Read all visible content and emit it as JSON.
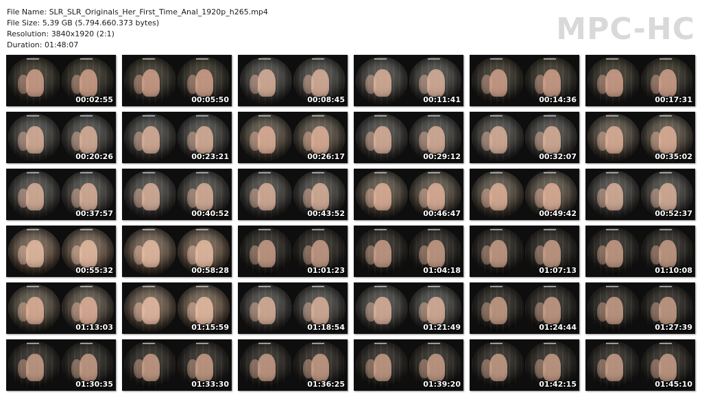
{
  "header": {
    "file_name_label": "File Name:",
    "file_name": "SLR_SLR_Originals_Her_First_Time_Anal_1920p_h265.mp4",
    "file_size_label": "File Size:",
    "file_size": "5,39 GB (5.794.660.373 bytes)",
    "resolution_label": "Resolution:",
    "resolution": "3840x1920 (2:1)",
    "duration_label": "Duration:",
    "duration": "01:48:07"
  },
  "logo": "MPC-HC",
  "thumbnails": [
    {
      "timestamp": "00:02:55",
      "tone": "t-a"
    },
    {
      "timestamp": "00:05:50",
      "tone": "t-a"
    },
    {
      "timestamp": "00:08:45",
      "tone": "t-b"
    },
    {
      "timestamp": "00:11:41",
      "tone": "t-b"
    },
    {
      "timestamp": "00:14:36",
      "tone": "t-a"
    },
    {
      "timestamp": "00:17:31",
      "tone": "t-a"
    },
    {
      "timestamp": "00:20:26",
      "tone": "t-b"
    },
    {
      "timestamp": "00:23:21",
      "tone": "t-b"
    },
    {
      "timestamp": "00:26:17",
      "tone": "t-c"
    },
    {
      "timestamp": "00:29:12",
      "tone": "t-b"
    },
    {
      "timestamp": "00:32:07",
      "tone": "t-b"
    },
    {
      "timestamp": "00:35:02",
      "tone": "t-c"
    },
    {
      "timestamp": "00:37:57",
      "tone": "t-b"
    },
    {
      "timestamp": "00:40:52",
      "tone": "t-b"
    },
    {
      "timestamp": "00:43:52",
      "tone": "t-b"
    },
    {
      "timestamp": "00:46:47",
      "tone": "t-c"
    },
    {
      "timestamp": "00:49:42",
      "tone": "t-c"
    },
    {
      "timestamp": "00:52:37",
      "tone": "t-b"
    },
    {
      "timestamp": "00:55:32",
      "tone": "t-e"
    },
    {
      "timestamp": "00:58:28",
      "tone": "t-e"
    },
    {
      "timestamp": "01:01:23",
      "tone": "t-d"
    },
    {
      "timestamp": "01:04:18",
      "tone": "t-d"
    },
    {
      "timestamp": "01:07:13",
      "tone": "t-d"
    },
    {
      "timestamp": "01:10:08",
      "tone": "t-d"
    },
    {
      "timestamp": "01:13:03",
      "tone": "t-c"
    },
    {
      "timestamp": "01:15:59",
      "tone": "t-e"
    },
    {
      "timestamp": "01:18:54",
      "tone": "t-b"
    },
    {
      "timestamp": "01:21:49",
      "tone": "t-b"
    },
    {
      "timestamp": "01:24:44",
      "tone": "t-d"
    },
    {
      "timestamp": "01:27:39",
      "tone": "t-d"
    },
    {
      "timestamp": "01:30:35",
      "tone": "t-d"
    },
    {
      "timestamp": "01:33:30",
      "tone": "t-d"
    },
    {
      "timestamp": "01:36:25",
      "tone": "t-d"
    },
    {
      "timestamp": "01:39:20",
      "tone": "t-d"
    },
    {
      "timestamp": "01:42:15",
      "tone": "t-d"
    },
    {
      "timestamp": "01:45:10",
      "tone": "t-d"
    }
  ]
}
